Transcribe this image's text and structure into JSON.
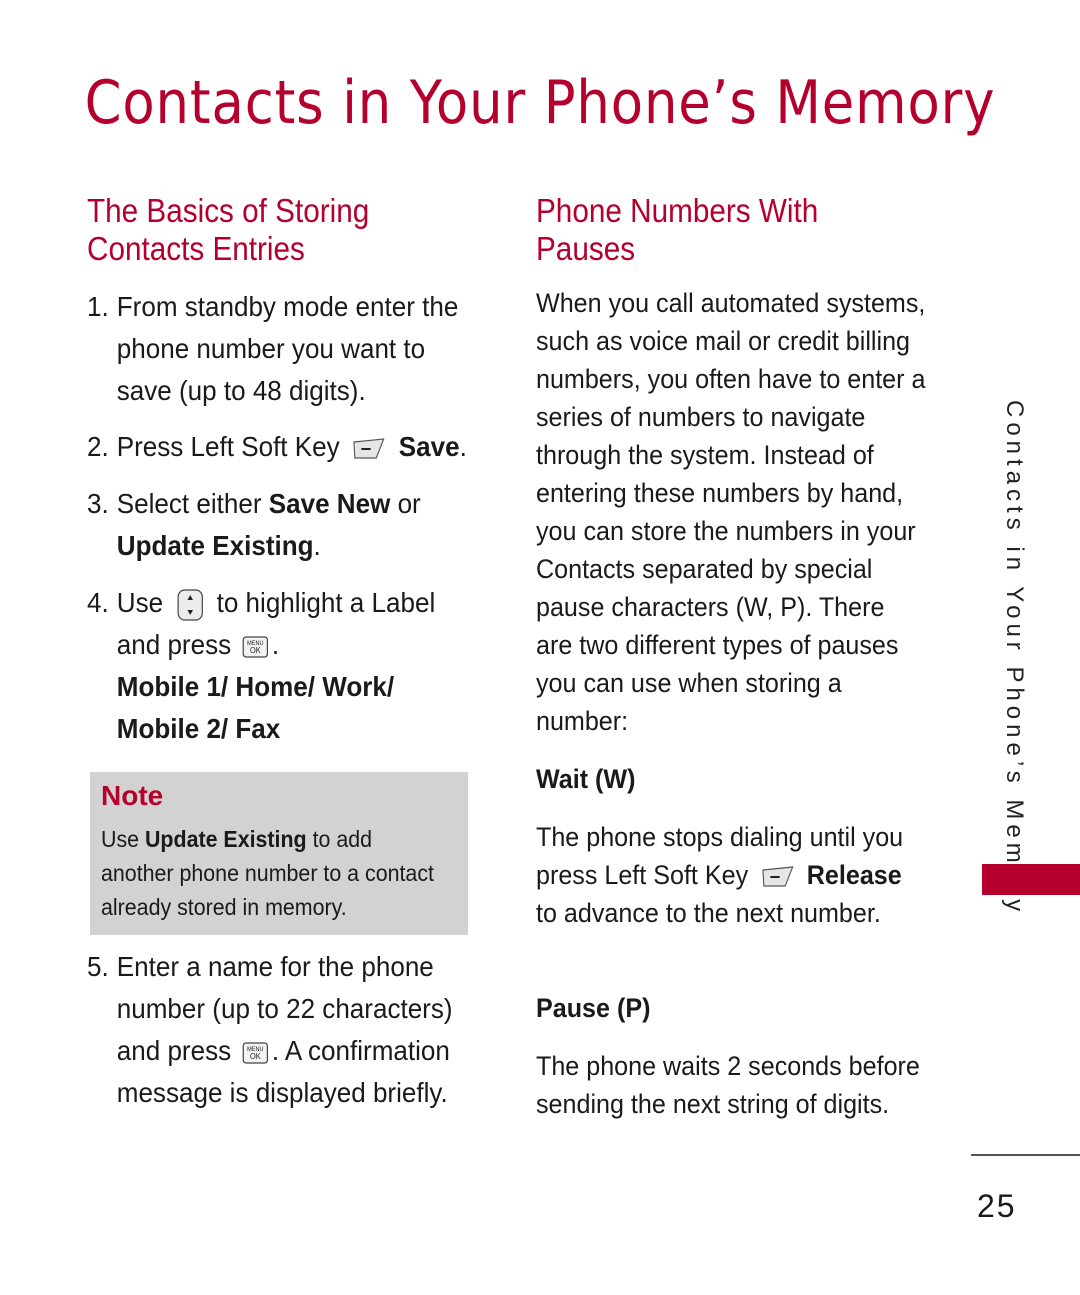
{
  "page": {
    "title": "Contacts in Your Phone’s Memory",
    "side_tab": "Contacts in Your Phone’s Memory",
    "page_number": "25",
    "accent_color": "#b5002d"
  },
  "left": {
    "heading_line1": "The Basics of Storing",
    "heading_line2": "Contacts Entries",
    "steps": [
      {
        "num": "1.",
        "text": "From standby mode enter the phone number you want to save (up to 48 digits)."
      },
      {
        "num": "2.",
        "pre": "Press Left Soft Key",
        "icon": "left-soft-key-icon",
        "bold": "Save",
        "post": "."
      },
      {
        "num": "3.",
        "pre": "Select either ",
        "bold1": "Save New",
        "mid": " or ",
        "bold2": "Update Existing",
        "post": "."
      },
      {
        "num": "4.",
        "pre": "Use",
        "icon1": "navigation-key-icon",
        "mid": "to highlight a Label and press",
        "icon2": "menu-ok-key-icon",
        "post": ".",
        "options": "Mobile 1/ Home/ Work/ Mobile 2/ Fax"
      },
      {
        "num": "5.",
        "pre": "Enter a name for the phone number (up to 22 characters) and press",
        "icon": "menu-ok-key-icon",
        "post": ". A confirmation message is displayed briefly."
      }
    ],
    "note": {
      "title": "Note",
      "pre": "Use ",
      "bold": "Update Existing",
      "post": " to add another phone number to a contact already stored in memory."
    }
  },
  "right": {
    "heading_line1": "Phone Numbers With",
    "heading_line2": "Pauses",
    "intro": "When you call automated systems, such as voice mail or credit billing numbers, you often have to enter a series of numbers to navigate through the system. Instead of entering these numbers by hand, you can store the numbers in your Contacts separated by special pause characters (W, P). There are two different types of pauses you can use when storing a number:",
    "wait": {
      "heading": "Wait (W)",
      "pre": "The phone stops dialing until you press Left Soft Key",
      "bold": "Release",
      "post": " to advance to the next number."
    },
    "pause": {
      "heading": "Pause (P)",
      "text": "The phone waits 2 seconds before sending the next string of digits."
    }
  }
}
